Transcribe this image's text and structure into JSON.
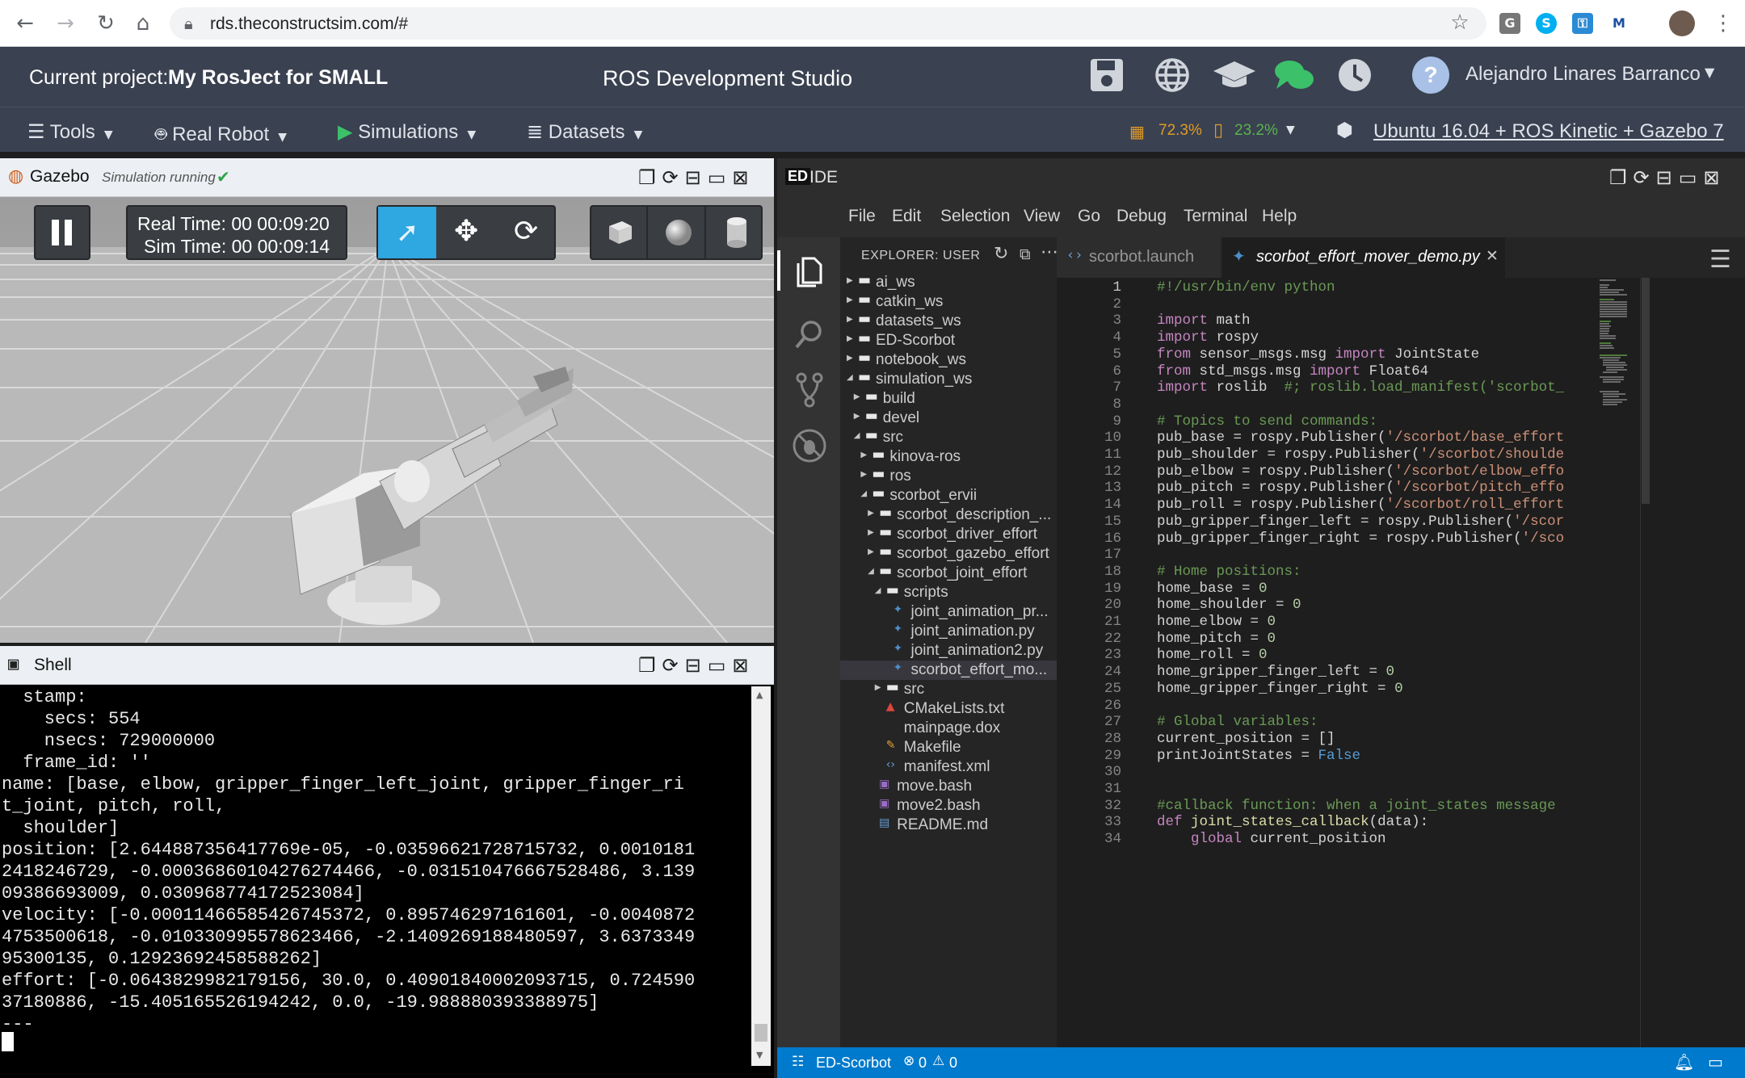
{
  "browser": {
    "url": "rds.theconstructsim.com/#"
  },
  "header": {
    "project_prefix": "Current project:",
    "project_name": "My RosJect for SMALL",
    "app_title": "ROS Development Studio",
    "user_name": "Alejandro Linares Barranco",
    "cpu": "72.3%",
    "mem": "23.2%",
    "environment": "Ubuntu 16.04 + ROS Kinetic + Gazebo 7"
  },
  "menu": {
    "tools": "Tools",
    "real_robot": "Real Robot",
    "simulations": "Simulations",
    "datasets": "Datasets"
  },
  "gazebo": {
    "title": "Gazebo",
    "status": "Simulation running",
    "real_time": "Real Time: 00 00:09:20",
    "sim_time": "Sim Time: 00 00:09:14"
  },
  "shell": {
    "title": "Shell",
    "lines": [
      "  stamp:",
      "    secs: 554",
      "    nsecs: 729000000",
      "  frame_id: ''",
      "name: [base, elbow, gripper_finger_left_joint, gripper_finger_ri",
      "t_joint, pitch, roll,",
      "  shoulder]",
      "position: [2.644887356417769e-05, -0.035966217287157 32, 0.0010181",
      "2418246729, -0.00036860104276274466, -0.031510476667528486, 3.139",
      "09386693009, 0.030968774172523084]",
      "velocity: [-0.00011466585426745372, 0.895746297161601, -0.0040872",
      "4753500618, -0.010330995578623466, -2.1409269188480597, 3.6373349",
      "95300135, 0.12923692458588262]",
      "effort: [-0.0643829982179156, 30.0, 0.40901840002093715, 0.724590",
      "37180886, -15.405165526194242, 0.0, -19.988880393388975]",
      "---"
    ]
  },
  "ide": {
    "title": "IDE",
    "menus": [
      "File",
      "Edit",
      "Selection",
      "View",
      "Go",
      "Debug",
      "Terminal",
      "Help"
    ],
    "explorer_title": "EXPLORER: USER",
    "tabs": [
      "scorbot.launch",
      "scorbot_effort_mover_demo.py"
    ],
    "tree": [
      {
        "label": "ai_ws",
        "depth": 0,
        "kind": "folder",
        "open": false
      },
      {
        "label": "catkin_ws",
        "depth": 0,
        "kind": "folder",
        "open": false
      },
      {
        "label": "datasets_ws",
        "depth": 0,
        "kind": "folder",
        "open": false
      },
      {
        "label": "ED-Scorbot",
        "depth": 0,
        "kind": "folder",
        "open": false
      },
      {
        "label": "notebook_ws",
        "depth": 0,
        "kind": "folder",
        "open": false
      },
      {
        "label": "simulation_ws",
        "depth": 0,
        "kind": "folder",
        "open": true
      },
      {
        "label": "build",
        "depth": 1,
        "kind": "folder",
        "open": false
      },
      {
        "label": "devel",
        "depth": 1,
        "kind": "folder",
        "open": false
      },
      {
        "label": "src",
        "depth": 1,
        "kind": "folder",
        "open": true
      },
      {
        "label": "kinova-ros",
        "depth": 2,
        "kind": "folder",
        "open": false
      },
      {
        "label": "ros",
        "depth": 2,
        "kind": "folder",
        "open": false
      },
      {
        "label": "scorbot_ervii",
        "depth": 2,
        "kind": "folder",
        "open": true
      },
      {
        "label": "scorbot_description_...",
        "depth": 3,
        "kind": "folder",
        "open": false
      },
      {
        "label": "scorbot_driver_effort",
        "depth": 3,
        "kind": "folder",
        "open": false
      },
      {
        "label": "scorbot_gazebo_effort",
        "depth": 3,
        "kind": "folder",
        "open": false
      },
      {
        "label": "scorbot_joint_effort",
        "depth": 3,
        "kind": "folder",
        "open": true
      },
      {
        "label": "scripts",
        "depth": 4,
        "kind": "folder",
        "open": true
      },
      {
        "label": "joint_animation_pr...",
        "depth": 5,
        "kind": "python"
      },
      {
        "label": "joint_animation.py",
        "depth": 5,
        "kind": "python"
      },
      {
        "label": "joint_animation2.py",
        "depth": 5,
        "kind": "python"
      },
      {
        "label": "scorbot_effort_mo...",
        "depth": 5,
        "kind": "python",
        "selected": true
      },
      {
        "label": "src",
        "depth": 4,
        "kind": "folder",
        "open": false
      },
      {
        "label": "CMakeLists.txt",
        "depth": 4,
        "kind": "cmake"
      },
      {
        "label": "mainpage.dox",
        "depth": 4,
        "kind": "file"
      },
      {
        "label": "Makefile",
        "depth": 4,
        "kind": "make"
      },
      {
        "label": "manifest.xml",
        "depth": 4,
        "kind": "xml"
      },
      {
        "label": "move.bash",
        "depth": 3,
        "kind": "bash"
      },
      {
        "label": "move2.bash",
        "depth": 3,
        "kind": "bash"
      },
      {
        "label": "README.md",
        "depth": 3,
        "kind": "md"
      }
    ],
    "code": [
      "#!/usr/bin/env python",
      "",
      "import math",
      "import rospy",
      "from sensor_msgs.msg import JointState",
      "from std_msgs.msg import Float64",
      "import roslib  #; roslib.load_manifest('scorbot_",
      "",
      "# Topics to send commands:",
      "pub_base = rospy.Publisher('/scorbot/base_effort",
      "pub_shoulder = rospy.Publisher('/scorbot/shoulde",
      "pub_elbow = rospy.Publisher('/scorbot/elbow_effo",
      "pub_pitch = rospy.Publisher('/scorbot/pitch_effo",
      "pub_roll = rospy.Publisher('/scorbot/roll_effort",
      "pub_gripper_finger_left = rospy.Publisher('/scor",
      "pub_gripper_finger_right = rospy.Publisher('/sco",
      "",
      "# Home positions:",
      "home_base = 0",
      "home_shoulder = 0",
      "home_elbow = 0",
      "home_pitch = 0",
      "home_roll = 0",
      "home_gripper_finger_left = 0",
      "home_gripper_finger_right = 0",
      "",
      "# Global variables:",
      "current_position = []",
      "printJointStates = False",
      "",
      "",
      "#callback function: when a joint_states message",
      "def joint_states_callback(data):",
      "    global current_position"
    ],
    "status": {
      "branch": "ED-Scorbot",
      "errors": "0",
      "warnings": "0"
    }
  }
}
